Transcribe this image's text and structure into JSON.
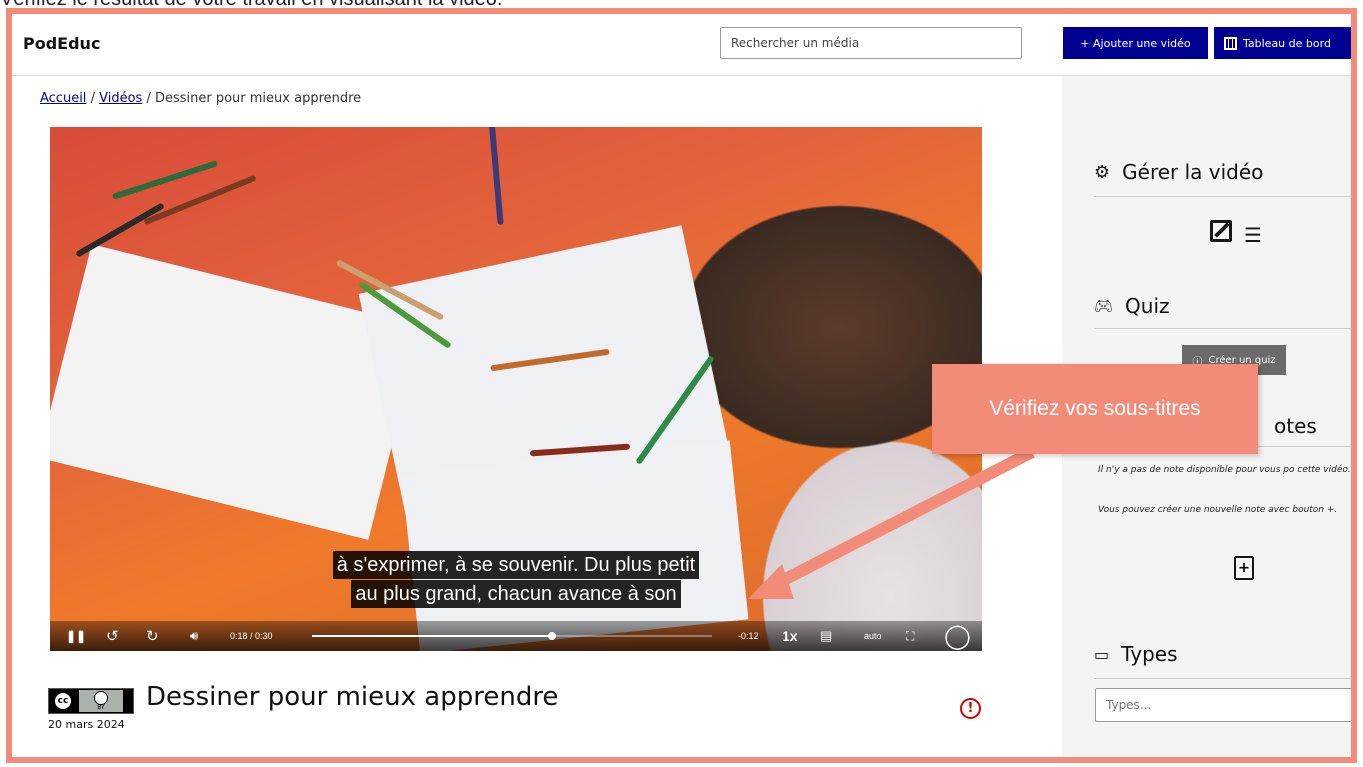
{
  "caption": "Vérifiez le résultat de votre travail en visualisant la vidéo.",
  "header": {
    "brand": "PodEduc",
    "search_placeholder": "Rechercher un média",
    "add_video_label": "+ Ajouter une vidéo",
    "dashboard_label": "Tableau de bord"
  },
  "breadcrumb": {
    "home": "Accueil",
    "sep1": "/",
    "videos": "Vidéos",
    "sep2": "/",
    "current": "Dessiner pour mieux apprendre"
  },
  "player": {
    "subtitle_line1": "à s'exprimer, à se souvenir. Du plus petit",
    "subtitle_line2": "au plus grand, chacun avance à son",
    "current_time": "0:18",
    "duration": "0:30",
    "time_display": "0:18 / 0:30",
    "remaining": "-0:12",
    "speed": "1x",
    "quality": "auto",
    "progress_fraction": 0.6
  },
  "video": {
    "title": "Dessiner pour mieux apprendre",
    "date": "20 mars 2024",
    "license": "cc BY"
  },
  "sidebar": {
    "manage_title": "Gérer la vidéo",
    "quiz_title": "Quiz",
    "create_quiz_label": "Créer un quiz",
    "notes_title_visible": "otes",
    "notes_empty_1": "Il n'y a pas de note disponible pour vous po cette vidéo.",
    "notes_empty_2": "Vous pouvez créer une nouvelle note avec bouton +.",
    "types_title": "Types",
    "types_placeholder": "Types..."
  },
  "annotation": {
    "callout_text": "Vérifiez vos sous-titres",
    "color": "#f28b78"
  },
  "colors": {
    "primary": "#000091",
    "frame": "#f28b78",
    "alert": "#ce0500"
  }
}
